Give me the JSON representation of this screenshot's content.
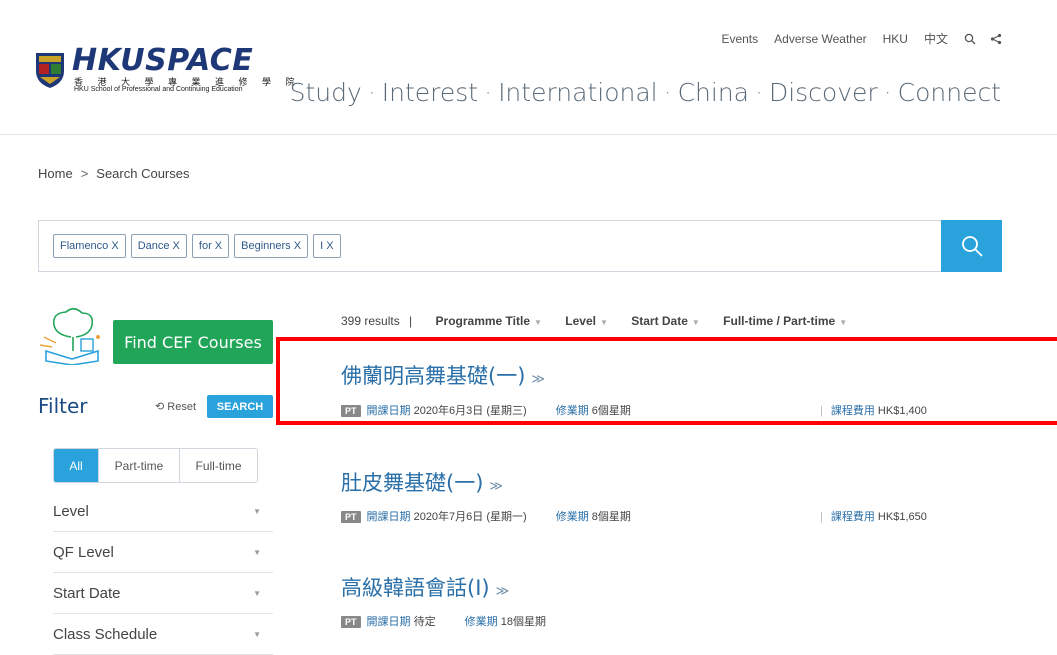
{
  "header": {
    "logo_text": "HKUSPACE",
    "logo_cn": "香 港 大 學 專 業 進 修 學 院",
    "logo_en": "HKU School of Professional and Continuing Education",
    "top_links": [
      "Events",
      "Adverse Weather",
      "HKU",
      "中文"
    ],
    "main_nav": [
      "Study",
      "Interest",
      "International",
      "China",
      "Discover",
      "Connect"
    ],
    "nav_separator": "·"
  },
  "breadcrumb": {
    "home": "Home",
    "separator": ">",
    "current": "Search Courses"
  },
  "search": {
    "chips": [
      "Flamenco X",
      "Dance X",
      "for X",
      "Beginners X",
      "I X"
    ]
  },
  "cef": {
    "button_label": "Find CEF Courses"
  },
  "filter": {
    "title": "Filter",
    "reset_label": "Reset",
    "search_label": "SEARCH",
    "mode_tabs": [
      "All",
      "Part-time",
      "Full-time"
    ],
    "facets": [
      "Level",
      "QF Level",
      "Start Date",
      "Class Schedule"
    ]
  },
  "results": {
    "count_text": "399 results",
    "count_divider": "|",
    "sort_options": [
      "Programme Title",
      "Level",
      "Start Date",
      "Full-time / Part-time"
    ]
  },
  "courses": [
    {
      "title": "佛蘭明高舞基礎(一)",
      "badge": "PT",
      "start_label": "開課日期",
      "start_value": "2020年6月3日 (星期三)",
      "duration_label": "修業期",
      "duration_value": "6個星期",
      "fee_label": "課程費用",
      "fee_value": "HK$1,400"
    },
    {
      "title": "肚皮舞基礎(一)",
      "badge": "PT",
      "start_label": "開課日期",
      "start_value": "2020年7月6日 (星期一)",
      "duration_label": "修業期",
      "duration_value": "8個星期",
      "fee_label": "課程費用",
      "fee_value": "HK$1,650"
    },
    {
      "title": "高級韓語會話(I)",
      "badge": "PT",
      "start_label": "開課日期",
      "start_value": "待定",
      "duration_label": "修業期",
      "duration_value": "18個星期",
      "fee_label": "",
      "fee_value": ""
    }
  ],
  "colors": {
    "accent": "#2aa2dc",
    "cef_green": "#21a559",
    "brand_blue": "#1e3877",
    "link_blue": "#2a6fa8",
    "highlight": "#ff0000"
  }
}
